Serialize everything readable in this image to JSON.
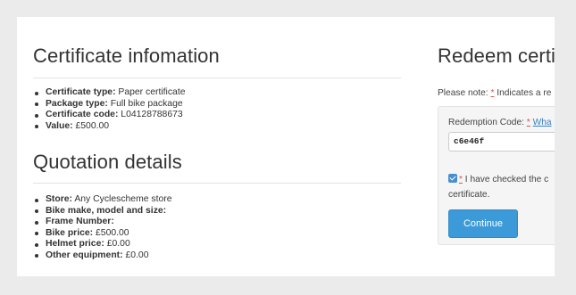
{
  "certificate_section": {
    "title": "Certificate infomation",
    "items": [
      {
        "label": "Certificate type:",
        "value": " Paper certificate"
      },
      {
        "label": "Package type:",
        "value": " Full bike package"
      },
      {
        "label": "Certificate code:",
        "value": " L04128788673"
      },
      {
        "label": "Value:",
        "value": " £500.00"
      }
    ]
  },
  "quotation_section": {
    "title": "Quotation details",
    "items": [
      {
        "label": "Store:",
        "value": " Any Cyclescheme store"
      },
      {
        "label": "Bike make, model and size:",
        "value": ""
      },
      {
        "label": "Frame Number:",
        "value": ""
      },
      {
        "label": "Bike price:",
        "value": " £500.00"
      },
      {
        "label": "Helmet price:",
        "value": " £0.00"
      },
      {
        "label": "Other equipment:",
        "value": " £0.00"
      }
    ]
  },
  "redeem_section": {
    "title": "Redeem certif",
    "note_prefix": "Please note: ",
    "note_marker": "*",
    "note_suffix": " Indicates a re",
    "code_label": "Redemption Code: ",
    "code_marker": "*",
    "code_link": "Wha",
    "code_value": "c6e46f",
    "checkbox_marker": "*",
    "checkbox_text_line1": " I have checked the c",
    "checkbox_text_line2": "certificate.",
    "continue_label": "Continue"
  }
}
